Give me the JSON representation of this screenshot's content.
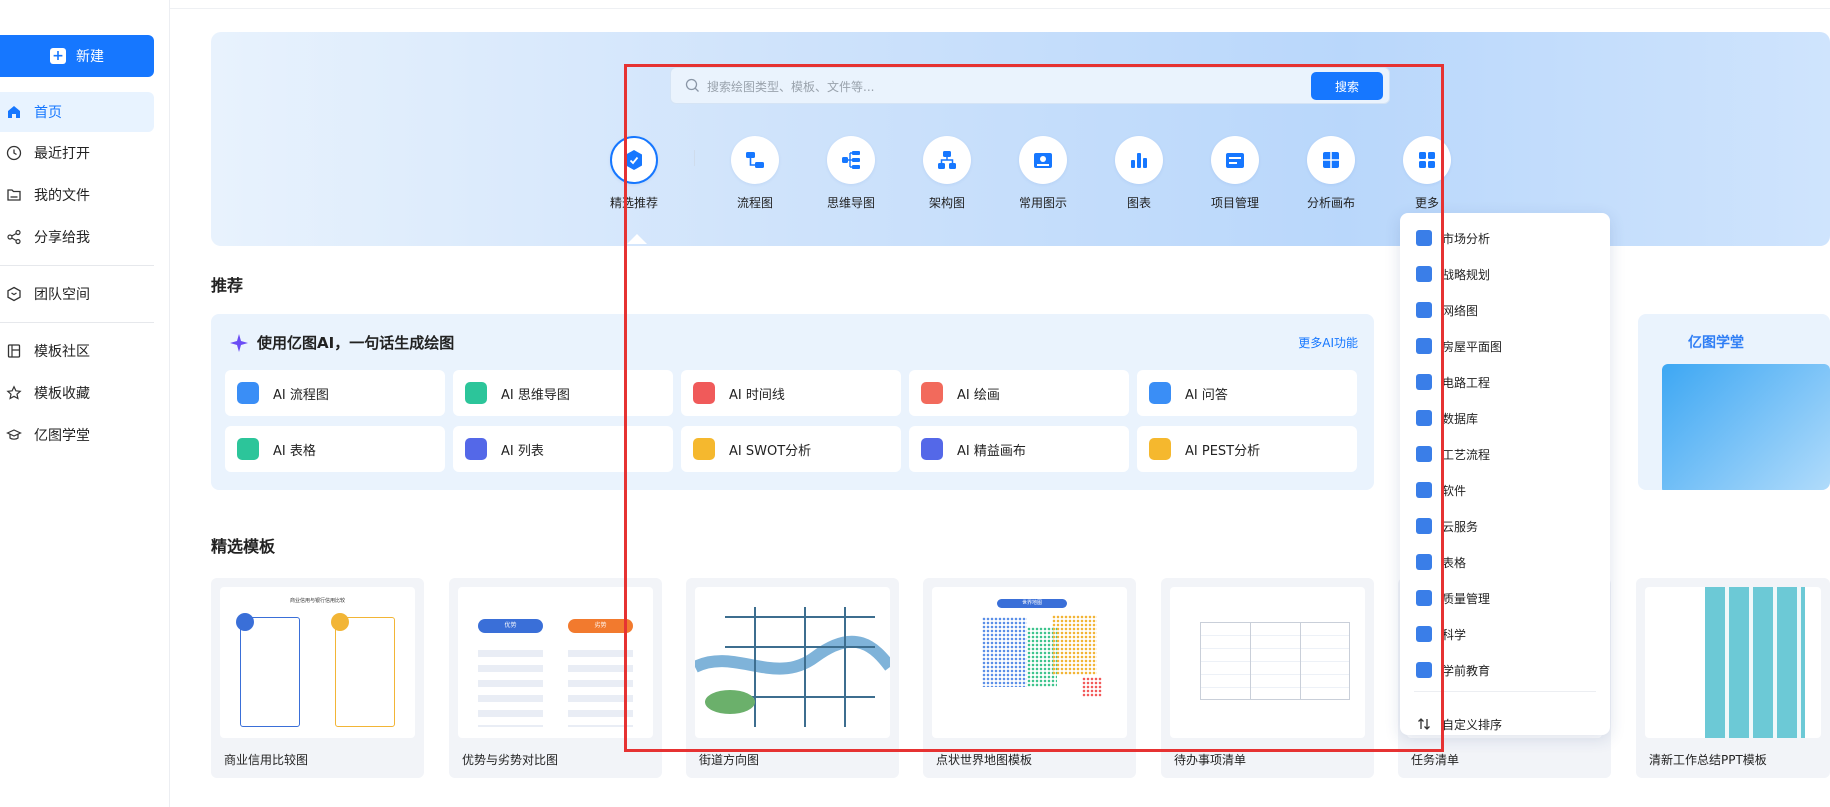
{
  "sidebar": {
    "new_label": "新建",
    "items": [
      {
        "label": "首页",
        "icon": "home-icon"
      },
      {
        "label": "最近打开",
        "icon": "clock-icon"
      },
      {
        "label": "我的文件",
        "icon": "folder-icon"
      },
      {
        "label": "分享给我",
        "icon": "share-icon"
      },
      {
        "label": "团队空间",
        "icon": "team-icon"
      },
      {
        "label": "模板社区",
        "icon": "template-icon"
      },
      {
        "label": "模板收藏",
        "icon": "star-icon"
      },
      {
        "label": "亿图学堂",
        "icon": "graduation-cap-icon"
      }
    ]
  },
  "search": {
    "placeholder": "搜索绘图类型、模板、文件等...",
    "button_label": "搜索"
  },
  "categories": [
    {
      "label": "精选推荐",
      "icon": "featured-icon"
    },
    {
      "label": "流程图",
      "icon": "flowchart-icon"
    },
    {
      "label": "思维导图",
      "icon": "mindmap-icon"
    },
    {
      "label": "架构图",
      "icon": "org-chart-icon"
    },
    {
      "label": "常用图示",
      "icon": "diagram-icon"
    },
    {
      "label": "图表",
      "icon": "bar-chart-icon"
    },
    {
      "label": "项目管理",
      "icon": "project-icon"
    },
    {
      "label": "分析画布",
      "icon": "canvas-icon"
    },
    {
      "label": "更多",
      "icon": "grid-icon"
    }
  ],
  "sections": {
    "recommend": "推荐",
    "templates": "精选模板"
  },
  "ai": {
    "title": "使用亿图AI，一句话生成绘图",
    "more": "更多AI功能",
    "cards": [
      {
        "label": "AI 流程图",
        "color": "#3a8ef6"
      },
      {
        "label": "AI 思维导图",
        "color": "#2cc59a"
      },
      {
        "label": "AI 时间线",
        "color": "#f05a5a"
      },
      {
        "label": "AI 绘画",
        "color": "#f26a5c"
      },
      {
        "label": "AI 问答",
        "color": "#3a8ef6"
      },
      {
        "label": "AI 表格",
        "color": "#2cc59a"
      },
      {
        "label": "AI 列表",
        "color": "#5468e8"
      },
      {
        "label": "AI SWOT分析",
        "color": "#f5b82e"
      },
      {
        "label": "AI 精益画布",
        "color": "#5468e8"
      },
      {
        "label": "AI PEST分析",
        "color": "#f5b82e"
      }
    ]
  },
  "promo": {
    "title": "亿图学堂"
  },
  "templates": [
    {
      "name": "商业信用比较图",
      "subtitle": "商业信用与银行信用比较"
    },
    {
      "name": "优势与劣势对比图",
      "left_tag": "优势",
      "right_tag": "劣势"
    },
    {
      "name": "街道方向图"
    },
    {
      "name": "点状世界地图模板",
      "subtitle": "世界地图"
    },
    {
      "name": "待办事项清单"
    },
    {
      "name": "任务清单"
    },
    {
      "name": "清新工作总结PPT模板"
    }
  ],
  "more_menu": {
    "items": [
      {
        "label": "市场分析",
        "color": "#3a7ee8"
      },
      {
        "label": "战略规划",
        "color": "#3a7ee8"
      },
      {
        "label": "网络图",
        "color": "#3a7ee8"
      },
      {
        "label": "房屋平面图",
        "color": "#3a7ee8"
      },
      {
        "label": "电路工程",
        "color": "#3a7ee8"
      },
      {
        "label": "数据库",
        "color": "#3a7ee8"
      },
      {
        "label": "工艺流程",
        "color": "#3a7ee8"
      },
      {
        "label": "软件",
        "color": "#3a7ee8"
      },
      {
        "label": "云服务",
        "color": "#3a7ee8"
      },
      {
        "label": "表格",
        "color": "#3a7ee8"
      },
      {
        "label": "质量管理",
        "color": "#3a7ee8"
      },
      {
        "label": "科学",
        "color": "#3a7ee8"
      },
      {
        "label": "学前教育",
        "color": "#3a7ee8"
      }
    ],
    "custom_sort": "自定义排序"
  },
  "colors": {
    "accent": "#1677ff",
    "highlight_box": "#e63232"
  }
}
